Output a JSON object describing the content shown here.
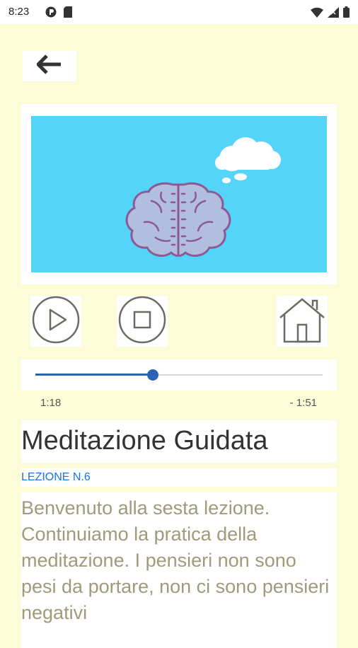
{
  "status_bar": {
    "time": "8:23",
    "icons_left": [
      "app-notification-icon",
      "sd-card-icon"
    ],
    "icons_right": [
      "wifi-icon",
      "cell-signal-icon",
      "battery-icon"
    ]
  },
  "nav": {
    "back_icon": "arrow-left-icon"
  },
  "player": {
    "illustration": "brain-with-thought-cloud",
    "video_bg_color": "#55d4f9",
    "controls": {
      "play_icon": "play-icon",
      "stop_icon": "stop-icon",
      "home_icon": "home-icon"
    },
    "progress_fraction": 0.41,
    "elapsed": "1:18",
    "remaining": "- 1:51",
    "accent_color": "#2a64b0"
  },
  "content": {
    "title": "Meditazione Guidata",
    "lesson": "LEZIONE N.6",
    "body": "Benvenuto alla sesta lezione. Continuiamo la pratica della meditazione. I pensieri non sono pesi da portare, non ci sono pensieri negativi"
  },
  "colors": {
    "page_bg": "#fdfcd8",
    "lesson_color": "#1a73e8",
    "body_text": "#a09a7c"
  }
}
